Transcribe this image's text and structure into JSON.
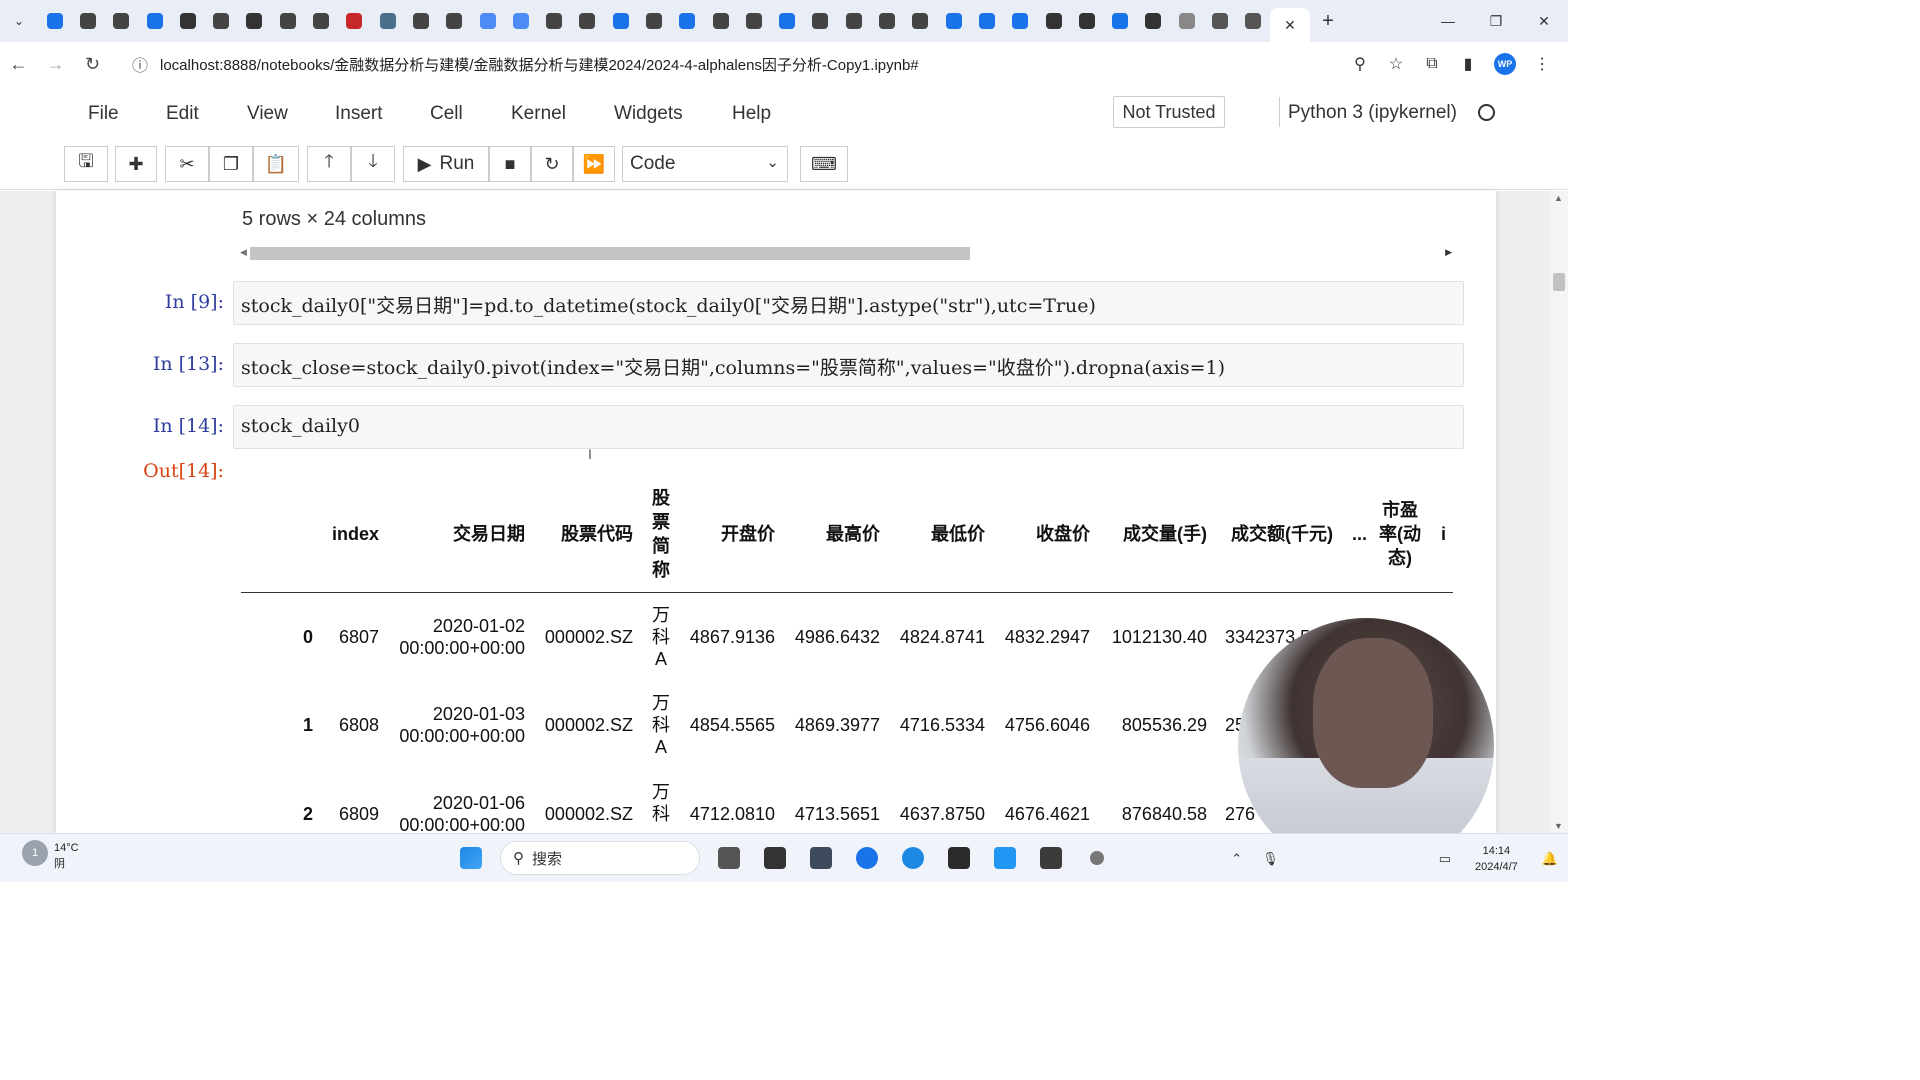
{
  "browser": {
    "active_tab_close": "✕",
    "new_tab": "+",
    "window_controls": [
      "—",
      "❐",
      "✕"
    ],
    "url": "localhost:8888/notebooks/金融数据分析与建模/金融数据分析与建模2024/2024-4-alphalens因子分析-Copy1.ipynb#",
    "tab_favicon_colors": [
      "#1a73e8",
      "#444",
      "#444",
      "#1a73e8",
      "#333",
      "#444",
      "#333",
      "#444",
      "#444",
      "#c62828",
      "#4a6f8a",
      "#444",
      "#444",
      "#4c8bf5",
      "#4c8bf5",
      "#444",
      "#444",
      "#1a73e8",
      "#444",
      "#1a73e8",
      "#444",
      "#444",
      "#1a73e8",
      "#444",
      "#444",
      "#444",
      "#444",
      "#1a73e8",
      "#1a73e8",
      "#1a73e8",
      "#333",
      "#333",
      "#1a73e8",
      "#333",
      "#888",
      "#555",
      "#555"
    ]
  },
  "jupyter": {
    "menu": [
      "File",
      "Edit",
      "View",
      "Insert",
      "Cell",
      "Kernel",
      "Widgets",
      "Help"
    ],
    "trust": "Not Trusted",
    "kernel": "Python 3 (ipykernel)",
    "run_label": "Run",
    "cell_type": "Code"
  },
  "notebook": {
    "output_summary": "5 rows × 24 columns",
    "cells": [
      {
        "prompt": "In  [9]:",
        "code": "stock_daily0[\"交易日期\"]=pd.to_datetime(stock_daily0[\"交易日期\"].astype(\"str\"),utc=True)"
      },
      {
        "prompt": "In  [13]:",
        "code": "stock_close=stock_daily0.pivot(index=\"交易日期\",columns=\"股票简称\",values=\"收盘价\").dropna(axis=1)"
      },
      {
        "prompt": "In  [14]:",
        "code": "stock_daily0"
      }
    ],
    "out_prompt": "Out[14]:"
  },
  "table": {
    "headers": {
      "index": "index",
      "date": "交易日期",
      "code": "股票代码",
      "name": [
        "股",
        "票",
        "简",
        "称"
      ],
      "open": "开盘价",
      "high": "最高价",
      "low": "最低价",
      "close": "收盘价",
      "volume": "成交量(手)",
      "amount": "成交额(千元)",
      "ellipsis": "...",
      "pe": [
        "市盈",
        "率(动",
        "态)"
      ],
      "last": "i"
    },
    "rows": [
      {
        "idx": "0",
        "index": "6807",
        "date1": "2020-01-02",
        "date2": "00:00:00+00:00",
        "code": "000002.SZ",
        "name": [
          "万",
          "科",
          "A"
        ],
        "open": "4867.9136",
        "high": "4986.6432",
        "low": "4824.8741",
        "close": "4832.2947",
        "volume": "1012130.40",
        "amount": "3342373.5"
      },
      {
        "idx": "1",
        "index": "6808",
        "date1": "2020-01-03",
        "date2": "00:00:00+00:00",
        "code": "000002.SZ",
        "name": [
          "万",
          "科",
          "A"
        ],
        "open": "4854.5565",
        "high": "4869.3977",
        "low": "4716.5334",
        "close": "4756.6046",
        "volume": "805536.29",
        "amount": "25"
      },
      {
        "idx": "2",
        "index": "6809",
        "date1": "2020-01-06",
        "date2": "00:00:00+00:00",
        "code": "000002.SZ",
        "name": [
          "万",
          "科"
        ],
        "open": "4712.0810",
        "high": "4713.5651",
        "low": "4637.8750",
        "close": "4676.4621",
        "volume": "876840.58",
        "amount": "276"
      }
    ]
  },
  "taskbar": {
    "weather_badge": "1",
    "temperature": "14°C",
    "condition": "阴",
    "search_label": "搜索",
    "time": "14:14",
    "date": "2024/4/7"
  }
}
